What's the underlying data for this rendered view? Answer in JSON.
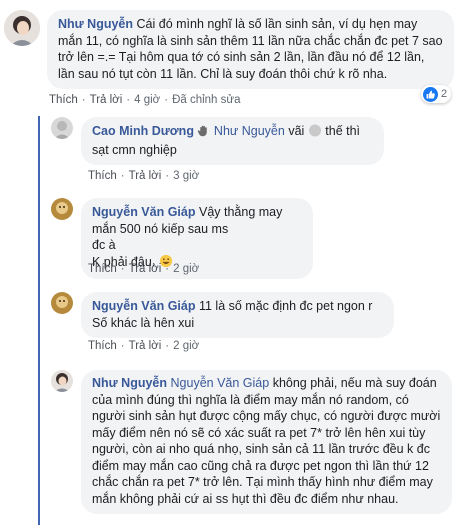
{
  "comments": [
    {
      "name": "Như Nguyễn",
      "text": "Cái đó mình nghĩ là số lần sinh sản, ví dụ hẹn may mắn 11, có nghĩa là sinh sản thêm 11 lần nữa chắc chắn đc pet 7 sao trở lên =.= Tại hôm qua tớ có sinh sản 2 lần, lần đầu nó để 12 lần, lần sau nó tụt còn 11 lần. Chỉ là suy đoán thôi chứ k rõ nha.",
      "actions": [
        "Thích",
        "Trả lời",
        "4 giờ",
        "Đã chỉnh sửa"
      ],
      "reaction_count": "2"
    },
    {
      "name": "Cao Minh Dương",
      "mention": "Như Nguyễn",
      "text_after": "vãi",
      "text_end": "thế thì sạt cmn nghiệp",
      "actions": [
        "Thích",
        "Trả lời",
        "3 giờ"
      ]
    },
    {
      "name": "Nguyễn Văn Giáp",
      "text_lines": [
        "Vậy thằng may mắn 500 nó kiếp sau ms",
        "đc à",
        "K phải đâu."
      ],
      "actions": [
        "Thích",
        "Trả lời",
        "2 giờ"
      ]
    },
    {
      "name": "Nguyễn Văn Giáp",
      "text": "11 là số mặc định đc pet ngon r",
      "text2": "Số khác là hên xui",
      "actions": [
        "Thích",
        "Trả lời",
        "2 giờ"
      ]
    },
    {
      "name": "Như Nguyễn",
      "mention": "Nguyễn Văn Giáp",
      "text": "không phải, nếu mà suy đoán của mình đúng thì nghĩa là điểm may mắn nó random, có người sinh sản hụt được cộng mấy chục, có người được mười mấy điểm nên nó sẽ có xác suất ra pet 7* trở lên hên xui tùy người, còn ai nho quá nhọ, sinh sản cả 11 lần trước đều k đc điểm may mắn cao cũng chả ra được pet ngon thì lần thứ 12 chắc chắn ra pet 7* trở lên. Tại mình thấy hình như điểm may mắn không phải cứ ai ss hụt thì đều đc điểm như nhau."
    }
  ],
  "colors": {
    "name": "#385898",
    "bubble": "#f2f3f5",
    "like": "#1877f2",
    "thread_line": "#4267b2"
  },
  "icons": [
    "like-icon",
    "wave-hand-icon",
    "grin-emoji-icon"
  ]
}
